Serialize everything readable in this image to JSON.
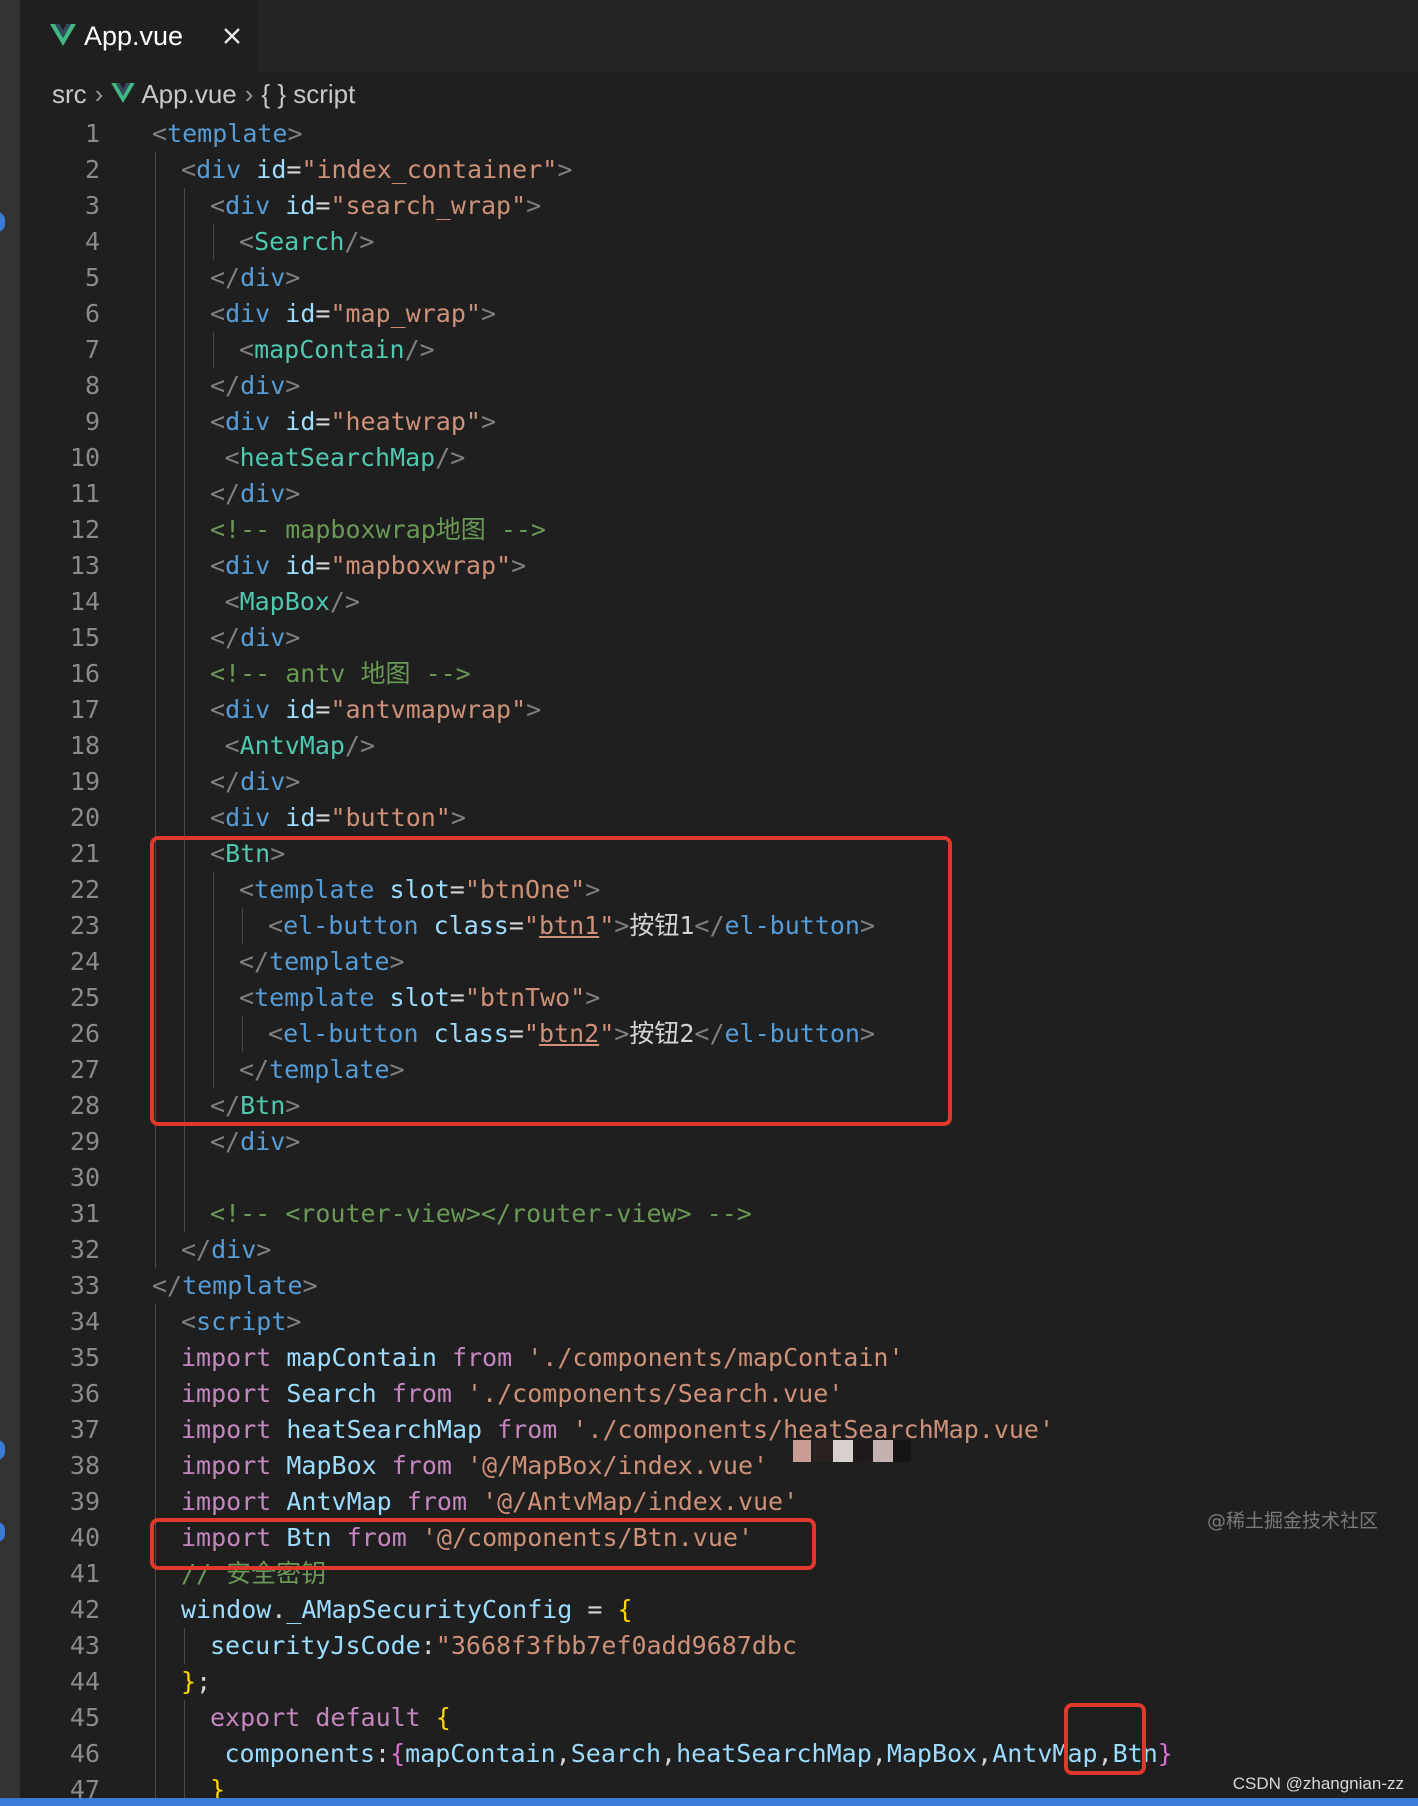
{
  "tab": {
    "title": "App.vue"
  },
  "breadcrumb": {
    "folder": "src",
    "file": "App.vue",
    "symbol": "{ } script"
  },
  "code_lines": [
    {
      "n": "1",
      "indent": 0,
      "tokens": [
        [
          "<",
          "punc"
        ],
        [
          "template",
          "tag"
        ],
        [
          ">",
          "punc"
        ]
      ]
    },
    {
      "n": "2",
      "indent": 1,
      "tokens": [
        [
          "<",
          "punc"
        ],
        [
          "div",
          "tag"
        ],
        [
          " ",
          "text"
        ],
        [
          "id",
          "attr"
        ],
        [
          "=",
          "text"
        ],
        [
          "\"index_container\"",
          "str"
        ],
        [
          ">",
          "punc"
        ]
      ]
    },
    {
      "n": "3",
      "indent": 2,
      "tokens": [
        [
          "<",
          "punc"
        ],
        [
          "div",
          "tag"
        ],
        [
          " ",
          "text"
        ],
        [
          "id",
          "attr"
        ],
        [
          "=",
          "text"
        ],
        [
          "\"search_wrap\"",
          "str"
        ],
        [
          ">",
          "punc"
        ]
      ]
    },
    {
      "n": "4",
      "indent": 3,
      "tokens": [
        [
          "<",
          "punc"
        ],
        [
          "Search",
          "comp"
        ],
        [
          "/>",
          "punc"
        ]
      ]
    },
    {
      "n": "5",
      "indent": 2,
      "tokens": [
        [
          "</",
          "punc"
        ],
        [
          "div",
          "tag"
        ],
        [
          ">",
          "punc"
        ]
      ]
    },
    {
      "n": "6",
      "indent": 2,
      "tokens": [
        [
          "<",
          "punc"
        ],
        [
          "div",
          "tag"
        ],
        [
          " ",
          "text"
        ],
        [
          "id",
          "attr"
        ],
        [
          "=",
          "text"
        ],
        [
          "\"map_wrap\"",
          "str"
        ],
        [
          ">",
          "punc"
        ]
      ]
    },
    {
      "n": "7",
      "indent": 3,
      "tokens": [
        [
          "<",
          "punc"
        ],
        [
          "mapContain",
          "comp"
        ],
        [
          "/>",
          "punc"
        ]
      ]
    },
    {
      "n": "8",
      "indent": 2,
      "tokens": [
        [
          "</",
          "punc"
        ],
        [
          "div",
          "tag"
        ],
        [
          ">",
          "punc"
        ]
      ]
    },
    {
      "n": "9",
      "indent": 2,
      "tokens": [
        [
          "<",
          "punc"
        ],
        [
          "div",
          "tag"
        ],
        [
          " ",
          "text"
        ],
        [
          "id",
          "attr"
        ],
        [
          "=",
          "text"
        ],
        [
          "\"heatwrap\"",
          "str"
        ],
        [
          ">",
          "punc"
        ]
      ]
    },
    {
      "n": "10",
      "indent": 2.5,
      "tokens": [
        [
          "<",
          "punc"
        ],
        [
          "heatSearchMap",
          "comp"
        ],
        [
          "/>",
          "punc"
        ]
      ]
    },
    {
      "n": "11",
      "indent": 2,
      "tokens": [
        [
          "</",
          "punc"
        ],
        [
          "div",
          "tag"
        ],
        [
          ">",
          "punc"
        ]
      ]
    },
    {
      "n": "12",
      "indent": 2,
      "tokens": [
        [
          "<!-- mapboxwrap地图 -->",
          "comment"
        ]
      ]
    },
    {
      "n": "13",
      "indent": 2,
      "tokens": [
        [
          "<",
          "punc"
        ],
        [
          "div",
          "tag"
        ],
        [
          " ",
          "text"
        ],
        [
          "id",
          "attr"
        ],
        [
          "=",
          "text"
        ],
        [
          "\"mapboxwrap\"",
          "str"
        ],
        [
          ">",
          "punc"
        ]
      ]
    },
    {
      "n": "14",
      "indent": 2.5,
      "tokens": [
        [
          "<",
          "punc"
        ],
        [
          "MapBox",
          "comp"
        ],
        [
          "/>",
          "punc"
        ]
      ]
    },
    {
      "n": "15",
      "indent": 2,
      "tokens": [
        [
          "</",
          "punc"
        ],
        [
          "div",
          "tag"
        ],
        [
          ">",
          "punc"
        ]
      ]
    },
    {
      "n": "16",
      "indent": 2,
      "tokens": [
        [
          "<!-- antv 地图 -->",
          "comment"
        ]
      ]
    },
    {
      "n": "17",
      "indent": 2,
      "tokens": [
        [
          "<",
          "punc"
        ],
        [
          "div",
          "tag"
        ],
        [
          " ",
          "text"
        ],
        [
          "id",
          "attr"
        ],
        [
          "=",
          "text"
        ],
        [
          "\"antvmapwrap\"",
          "str"
        ],
        [
          ">",
          "punc"
        ]
      ]
    },
    {
      "n": "18",
      "indent": 2.5,
      "tokens": [
        [
          "<",
          "punc"
        ],
        [
          "AntvMap",
          "comp"
        ],
        [
          "/>",
          "punc"
        ]
      ]
    },
    {
      "n": "19",
      "indent": 2,
      "tokens": [
        [
          "</",
          "punc"
        ],
        [
          "div",
          "tag"
        ],
        [
          ">",
          "punc"
        ]
      ]
    },
    {
      "n": "20",
      "indent": 2,
      "tokens": [
        [
          "<",
          "punc"
        ],
        [
          "div",
          "tag"
        ],
        [
          " ",
          "text"
        ],
        [
          "id",
          "attr"
        ],
        [
          "=",
          "text"
        ],
        [
          "\"button\"",
          "str"
        ],
        [
          ">",
          "punc"
        ]
      ]
    },
    {
      "n": "21",
      "indent": 2,
      "tokens": [
        [
          "<",
          "punc"
        ],
        [
          "Btn",
          "comp"
        ],
        [
          ">",
          "punc"
        ]
      ]
    },
    {
      "n": "22",
      "indent": 3,
      "tokens": [
        [
          "<",
          "punc"
        ],
        [
          "template",
          "tag"
        ],
        [
          " ",
          "text"
        ],
        [
          "slot",
          "attr"
        ],
        [
          "=",
          "text"
        ],
        [
          "\"btnOne\"",
          "str"
        ],
        [
          ">",
          "punc"
        ]
      ]
    },
    {
      "n": "23",
      "indent": 4,
      "tokens": [
        [
          "<",
          "punc"
        ],
        [
          "el-button",
          "tag"
        ],
        [
          " ",
          "text"
        ],
        [
          "class",
          "attr"
        ],
        [
          "=",
          "text"
        ],
        [
          "\"",
          "str"
        ],
        [
          "btn1",
          "str-ul"
        ],
        [
          "\"",
          "str"
        ],
        [
          ">",
          "punc"
        ],
        [
          "按钮1",
          "text"
        ],
        [
          "</",
          "punc"
        ],
        [
          "el-button",
          "tag"
        ],
        [
          ">",
          "punc"
        ]
      ]
    },
    {
      "n": "24",
      "indent": 3,
      "tokens": [
        [
          "</",
          "punc"
        ],
        [
          "template",
          "tag"
        ],
        [
          ">",
          "punc"
        ]
      ]
    },
    {
      "n": "25",
      "indent": 3,
      "tokens": [
        [
          "<",
          "punc"
        ],
        [
          "template",
          "tag"
        ],
        [
          " ",
          "text"
        ],
        [
          "slot",
          "attr"
        ],
        [
          "=",
          "text"
        ],
        [
          "\"btnTwo\"",
          "str"
        ],
        [
          ">",
          "punc"
        ]
      ]
    },
    {
      "n": "26",
      "indent": 4,
      "tokens": [
        [
          "<",
          "punc"
        ],
        [
          "el-button",
          "tag"
        ],
        [
          " ",
          "text"
        ],
        [
          "class",
          "attr"
        ],
        [
          "=",
          "text"
        ],
        [
          "\"",
          "str"
        ],
        [
          "btn2",
          "str-ul"
        ],
        [
          "\"",
          "str"
        ],
        [
          ">",
          "punc"
        ],
        [
          "按钮2",
          "text"
        ],
        [
          "</",
          "punc"
        ],
        [
          "el-button",
          "tag"
        ],
        [
          ">",
          "punc"
        ]
      ]
    },
    {
      "n": "27",
      "indent": 3,
      "tokens": [
        [
          "</",
          "punc"
        ],
        [
          "template",
          "tag"
        ],
        [
          ">",
          "punc"
        ]
      ]
    },
    {
      "n": "28",
      "indent": 2,
      "tokens": [
        [
          "</",
          "punc"
        ],
        [
          "Btn",
          "comp"
        ],
        [
          ">",
          "punc"
        ]
      ]
    },
    {
      "n": "29",
      "indent": 2,
      "tokens": [
        [
          "</",
          "punc"
        ],
        [
          "div",
          "tag"
        ],
        [
          ">",
          "punc"
        ]
      ]
    },
    {
      "n": "30",
      "indent": 2,
      "tokens": []
    },
    {
      "n": "31",
      "indent": 2,
      "tokens": [
        [
          "<!-- <router-view></router-view> -->",
          "comment"
        ]
      ]
    },
    {
      "n": "32",
      "indent": 1,
      "tokens": [
        [
          "</",
          "punc"
        ],
        [
          "div",
          "tag"
        ],
        [
          ">",
          "punc"
        ]
      ]
    },
    {
      "n": "33",
      "indent": 0,
      "tokens": [
        [
          "</",
          "punc"
        ],
        [
          "template",
          "tag"
        ],
        [
          ">",
          "punc"
        ]
      ]
    },
    {
      "n": "34",
      "indent": 1,
      "tokens": [
        [
          "<",
          "punc"
        ],
        [
          "script",
          "tag"
        ],
        [
          ">",
          "punc"
        ]
      ]
    },
    {
      "n": "35",
      "indent": 1,
      "tokens": [
        [
          "import",
          "kw"
        ],
        [
          " ",
          "text"
        ],
        [
          "mapContain",
          "attr"
        ],
        [
          " ",
          "text"
        ],
        [
          "from",
          "kw"
        ],
        [
          " ",
          "text"
        ],
        [
          "'./components/mapContain'",
          "str"
        ]
      ]
    },
    {
      "n": "36",
      "indent": 1,
      "tokens": [
        [
          "import",
          "kw"
        ],
        [
          " ",
          "text"
        ],
        [
          "Search",
          "attr"
        ],
        [
          " ",
          "text"
        ],
        [
          "from",
          "kw"
        ],
        [
          " ",
          "text"
        ],
        [
          "'./components/Search.vue'",
          "str"
        ]
      ]
    },
    {
      "n": "37",
      "indent": 1,
      "tokens": [
        [
          "import",
          "kw"
        ],
        [
          " ",
          "text"
        ],
        [
          "heatSearchMap",
          "attr"
        ],
        [
          " ",
          "text"
        ],
        [
          "from",
          "kw"
        ],
        [
          " ",
          "text"
        ],
        [
          "'./components/heatSearchMap.vue'",
          "str"
        ]
      ]
    },
    {
      "n": "38",
      "indent": 1,
      "tokens": [
        [
          "import",
          "kw"
        ],
        [
          " ",
          "text"
        ],
        [
          "MapBox",
          "attr"
        ],
        [
          " ",
          "text"
        ],
        [
          "from",
          "kw"
        ],
        [
          " ",
          "text"
        ],
        [
          "'@/MapBox/index.vue'",
          "str"
        ]
      ]
    },
    {
      "n": "39",
      "indent": 1,
      "tokens": [
        [
          "import",
          "kw"
        ],
        [
          " ",
          "text"
        ],
        [
          "AntvMap",
          "attr"
        ],
        [
          " ",
          "text"
        ],
        [
          "from",
          "kw"
        ],
        [
          " ",
          "text"
        ],
        [
          "'@/AntvMap/index.vue'",
          "str"
        ]
      ]
    },
    {
      "n": "40",
      "indent": 1,
      "tokens": [
        [
          "import",
          "kw"
        ],
        [
          " ",
          "text"
        ],
        [
          "Btn",
          "attr"
        ],
        [
          " ",
          "text"
        ],
        [
          "from",
          "kw"
        ],
        [
          " ",
          "text"
        ],
        [
          "'@/components/Btn.vue'",
          "str"
        ]
      ]
    },
    {
      "n": "41",
      "indent": 1,
      "tokens": [
        [
          "// 安全密钥",
          "comment"
        ]
      ]
    },
    {
      "n": "42",
      "indent": 1,
      "tokens": [
        [
          "window",
          "attr"
        ],
        [
          ".",
          "text"
        ],
        [
          "_AMapSecurityConfig",
          "attr"
        ],
        [
          " = ",
          "text"
        ],
        [
          "{",
          "brace"
        ]
      ]
    },
    {
      "n": "43",
      "indent": 2,
      "tokens": [
        [
          "securityJsCode",
          "attr"
        ],
        [
          ":",
          "text"
        ],
        [
          "\"3668f3fbb7ef0add9687dbc",
          "str"
        ]
      ]
    },
    {
      "n": "44",
      "indent": 1,
      "tokens": [
        [
          "}",
          "brace"
        ],
        [
          ";",
          "text"
        ]
      ]
    },
    {
      "n": "45",
      "indent": 2,
      "tokens": [
        [
          "export",
          "kw"
        ],
        [
          " ",
          "text"
        ],
        [
          "default",
          "kw"
        ],
        [
          " ",
          "text"
        ],
        [
          "{",
          "brace"
        ]
      ]
    },
    {
      "n": "46",
      "indent": 2.5,
      "tokens": [
        [
          "components",
          "attr"
        ],
        [
          ":",
          "text"
        ],
        [
          "{",
          "brace2"
        ],
        [
          "mapContain",
          "attr"
        ],
        [
          ",",
          "text"
        ],
        [
          "Search",
          "attr"
        ],
        [
          ",",
          "text"
        ],
        [
          "heatSearchMap",
          "attr"
        ],
        [
          ",",
          "text"
        ],
        [
          "MapBox",
          "attr"
        ],
        [
          ",",
          "text"
        ],
        [
          "AntvMap",
          "attr"
        ],
        [
          ",",
          "text"
        ],
        [
          "Btn",
          "attr"
        ],
        [
          "}",
          "brace2"
        ]
      ]
    },
    {
      "n": "47",
      "indent": 2,
      "tokens": [
        [
          "}",
          "brace"
        ]
      ]
    }
  ],
  "watermark": "@稀土掘金技术社区",
  "footer_credit": "CSDN @zhangnian-zz",
  "colors": {
    "highlight_box": "#e0392b",
    "vue_logo_outer": "#41b883",
    "vue_logo_inner": "#35495e",
    "status_bar": "#3a7bd5"
  },
  "icons": {
    "tab_icon": "vue-logo-icon",
    "close": "close-icon",
    "breadcrumb_sep": "chevron-right-icon"
  }
}
